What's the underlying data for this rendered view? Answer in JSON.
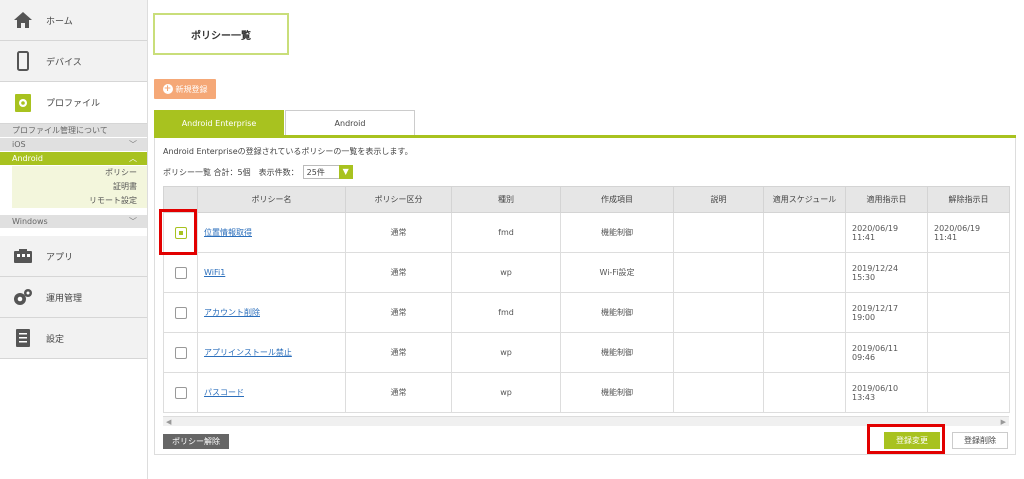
{
  "sidebar": {
    "home": "ホーム",
    "device": "デバイス",
    "profile": "プロファイル",
    "profile_about": "プロファイル管理について",
    "ios": "iOS",
    "android": "Android",
    "android_children": [
      "ポリシー",
      "証明書",
      "リモート設定"
    ],
    "windows": "Windows",
    "app": "アプリ",
    "ops": "運用管理",
    "settings": "設定"
  },
  "page": {
    "title": "ポリシー一覧",
    "new_button": "新規登録",
    "tabs": [
      "Android Enterprise",
      "Android"
    ],
    "description": "Android Enterpriseの登録されているポリシーの一覧を表示します。",
    "count_label": "ポリシー一覧 合計：5個　表示件数：",
    "per_page": "25件"
  },
  "table": {
    "headers": [
      "",
      "ポリシー名",
      "ポリシー区分",
      "種別",
      "作成項目",
      "説明",
      "適用スケジュール",
      "適用指示日",
      "解除指示日"
    ],
    "rows": [
      {
        "checked": true,
        "name": "位置情報取得",
        "kubun": "通常",
        "type": "fmd",
        "item": "機能制御",
        "desc": "",
        "schedule": "",
        "applied": "2020/06/19\n11:41",
        "released": "2020/06/19\n11:41"
      },
      {
        "checked": false,
        "name": "WiFi1",
        "kubun": "通常",
        "type": "wp",
        "item": "Wi-Fi設定",
        "desc": "",
        "schedule": "",
        "applied": "2019/12/24\n15:30",
        "released": ""
      },
      {
        "checked": false,
        "name": "アカウント削除",
        "kubun": "通常",
        "type": "fmd",
        "item": "機能制御",
        "desc": "",
        "schedule": "",
        "applied": "2019/12/17\n19:00",
        "released": ""
      },
      {
        "checked": false,
        "name": "アプリインストール禁止",
        "kubun": "通常",
        "type": "wp",
        "item": "機能制御",
        "desc": "",
        "schedule": "",
        "applied": "2019/06/11\n09:46",
        "released": ""
      },
      {
        "checked": false,
        "name": "パスコード",
        "kubun": "通常",
        "type": "wp",
        "item": "機能制御",
        "desc": "",
        "schedule": "",
        "applied": "2019/06/10\n13:43",
        "released": ""
      }
    ]
  },
  "actions": {
    "unregister": "ポリシー解除",
    "register_change": "登録変更",
    "register_delete": "登録削除"
  },
  "colors": {
    "accent": "#a8c21f",
    "orange": "#f5a877",
    "highlight": "#e20000"
  }
}
